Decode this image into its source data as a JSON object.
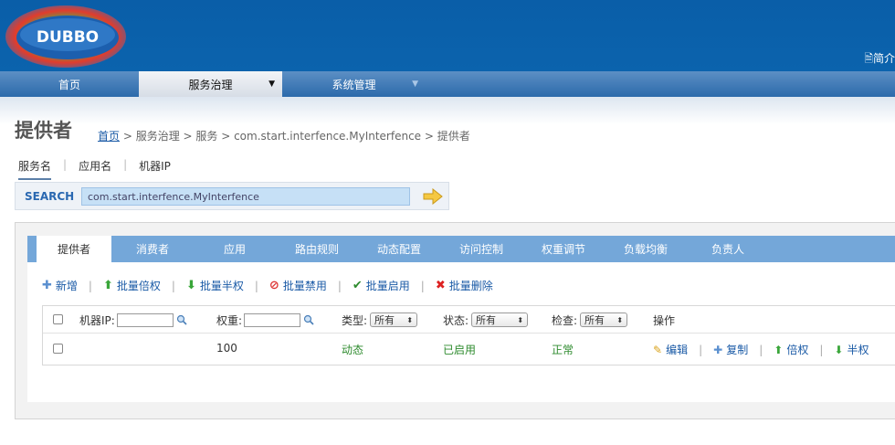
{
  "header": {
    "logo_text": "DUBBO",
    "right_text": "简介"
  },
  "mainnav": {
    "items": [
      {
        "label": "首页"
      },
      {
        "label": "服务治理",
        "caret": "▼"
      },
      {
        "label": "系统管理",
        "caret": "▼"
      }
    ]
  },
  "page": {
    "title": "提供者",
    "breadcrumb": {
      "home": "首页",
      "rest": " > 服务治理 > 服务 > com.start.interfence.MyInterfence > 提供者"
    }
  },
  "search": {
    "tabs": [
      "服务名",
      "应用名",
      "机器IP"
    ],
    "label": "SEARCH",
    "value": "com.start.interfence.MyInterfence"
  },
  "tabs": [
    "提供者",
    "消费者",
    "应用",
    "路由规则",
    "动态配置",
    "访问控制",
    "权重调节",
    "负载均衡",
    "负责人"
  ],
  "toolbar": {
    "add": "新增",
    "double": "批量倍权",
    "half": "批量半权",
    "disable": "批量禁用",
    "enable": "批量启用",
    "delete": "批量删除"
  },
  "table": {
    "headers": {
      "ip": "机器IP:",
      "weight": "权重:",
      "type": "类型:",
      "status": "状态:",
      "check": "检查:",
      "ops": "操作"
    },
    "filters": {
      "type": "所有",
      "status": "所有",
      "check": "所有"
    },
    "rows": [
      {
        "ip": "",
        "weight": "100",
        "type": "动态",
        "status": "已启用",
        "check": "正常",
        "ops": [
          "编辑",
          "复制",
          "倍权",
          "半权"
        ]
      }
    ]
  },
  "colors": {
    "header_bg": "#0b63ad",
    "tab_bar": "#74a7d9",
    "link": "#1a5aa6",
    "ok_green": "#2e8b2e"
  }
}
